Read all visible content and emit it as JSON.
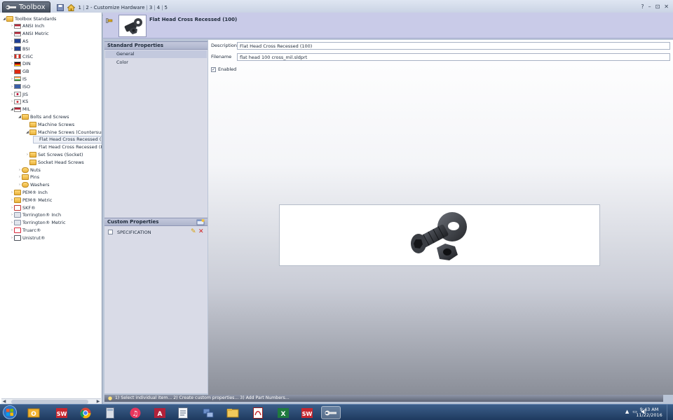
{
  "app": {
    "menu_label": "Toolbox",
    "breadcrumb": [
      "1",
      "2 - Customize Hardware",
      "3",
      "4",
      "5"
    ],
    "window_controls": [
      "?",
      "–",
      "⊡",
      "✕"
    ]
  },
  "tree": [
    {
      "label": "Toolbox Standards",
      "indent": 0,
      "icon": "folder",
      "exp": "◢"
    },
    {
      "label": "ANSI Inch",
      "indent": 1,
      "icon": "flag-us",
      "exp": "›"
    },
    {
      "label": "ANSI Metric",
      "indent": 1,
      "icon": "flag-us",
      "exp": "›"
    },
    {
      "label": "AS",
      "indent": 1,
      "icon": "flag-au",
      "exp": "›"
    },
    {
      "label": "BSI",
      "indent": 1,
      "icon": "flag-uk",
      "exp": "›"
    },
    {
      "label": "CISC",
      "indent": 1,
      "icon": "flag-ca",
      "exp": "›"
    },
    {
      "label": "DIN",
      "indent": 1,
      "icon": "flag-de",
      "exp": "›"
    },
    {
      "label": "GB",
      "indent": 1,
      "icon": "flag-cn",
      "exp": "›"
    },
    {
      "label": "IS",
      "indent": 1,
      "icon": "flag-in",
      "exp": "›"
    },
    {
      "label": "ISO",
      "indent": 1,
      "icon": "flag-iso",
      "exp": "›"
    },
    {
      "label": "JIS",
      "indent": 1,
      "icon": "flag-jp",
      "exp": "›"
    },
    {
      "label": "KS",
      "indent": 1,
      "icon": "flag-kr",
      "exp": "›"
    },
    {
      "label": "MIL",
      "indent": 1,
      "icon": "flag-us",
      "exp": "◢"
    },
    {
      "label": "Bolts and Screws",
      "indent": 2,
      "icon": "folder",
      "exp": "◢"
    },
    {
      "label": "Machine Screws",
      "indent": 3,
      "icon": "folder",
      "exp": ""
    },
    {
      "label": "Machine Screws (Countersunk)",
      "indent": 3,
      "icon": "folder",
      "exp": "◢"
    },
    {
      "label": "Flat Head Cross Recessed (100)",
      "indent": 4,
      "icon": "none",
      "exp": "",
      "selected": true
    },
    {
      "label": "Flat Head Cross Recessed (82)",
      "indent": 4,
      "icon": "none",
      "exp": ""
    },
    {
      "label": "Set Screws (Socket)",
      "indent": 3,
      "icon": "folder",
      "exp": "›"
    },
    {
      "label": "Socket Head Screws",
      "indent": 3,
      "icon": "folder",
      "exp": ""
    },
    {
      "label": "Nuts",
      "indent": 2,
      "icon": "folder-round",
      "exp": "›"
    },
    {
      "label": "Pins",
      "indent": 2,
      "icon": "folder",
      "exp": "›"
    },
    {
      "label": "Washers",
      "indent": 2,
      "icon": "folder-round",
      "exp": "›"
    },
    {
      "label": "PEM® Inch",
      "indent": 1,
      "icon": "folder",
      "exp": "›"
    },
    {
      "label": "PEM® Metric",
      "indent": 1,
      "icon": "folder",
      "exp": "›"
    },
    {
      "label": "SKF®",
      "indent": 1,
      "icon": "skf",
      "exp": "›"
    },
    {
      "label": "Torrington® Inch",
      "indent": 1,
      "icon": "box",
      "exp": "›"
    },
    {
      "label": "Torrington® Metric",
      "indent": 1,
      "icon": "box",
      "exp": "›"
    },
    {
      "label": "Truarc®",
      "indent": 1,
      "icon": "ring",
      "exp": "›"
    },
    {
      "label": "Unistrut®",
      "indent": 1,
      "icon": "unistrut",
      "exp": "›"
    }
  ],
  "header": {
    "title": "Flat Head Cross Recessed (100)"
  },
  "standard_properties": {
    "title": "Standard Properties",
    "items": [
      "General",
      "Color"
    ]
  },
  "custom_properties": {
    "title": "Custom Properties",
    "items": [
      "SPECIFICATION"
    ]
  },
  "form": {
    "description_label": "Description",
    "description_value": "Flat Head Cross Recessed (100)",
    "filename_label": "Filename",
    "filename_value": "flat head 100 cross_mil.sldprt",
    "enabled_label": "Enabled",
    "enabled_checked": "✓"
  },
  "status_text": "1) Select individual item...   2) Create custom properties...   3) Add Part Numbers...",
  "clock": {
    "time": "9:43 AM",
    "date": "11/22/2016"
  }
}
